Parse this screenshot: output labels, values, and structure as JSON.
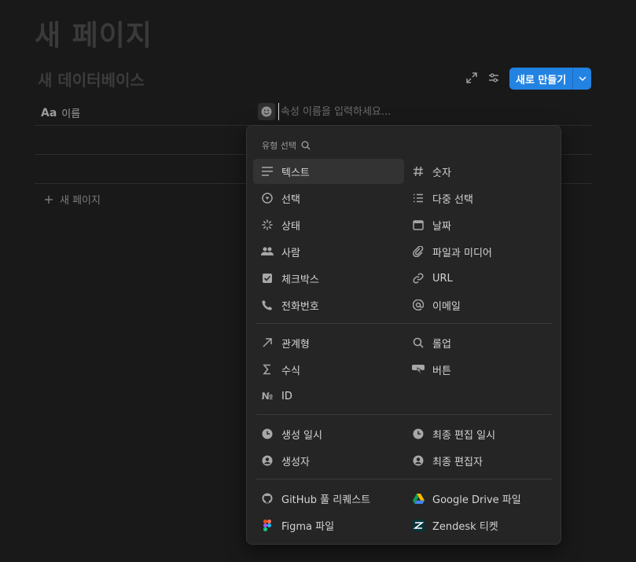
{
  "page": {
    "title": "새 페이지"
  },
  "database": {
    "title": "새 데이터베이스"
  },
  "toolbar": {
    "new_label": "새로 만들기"
  },
  "table": {
    "name_col_icon": "Aa",
    "name_col_label": "이름",
    "property_placeholder": "속성 이름을 입력하세요...",
    "add_page_label": "새 페이지"
  },
  "menu": {
    "header": "유형 선택",
    "items": [
      {
        "label": "텍스트",
        "icon": "text-icon"
      },
      {
        "label": "숫자",
        "icon": "number-icon"
      },
      {
        "label": "선택",
        "icon": "select-icon"
      },
      {
        "label": "다중 선택",
        "icon": "multi-select-icon"
      },
      {
        "label": "상태",
        "icon": "status-icon"
      },
      {
        "label": "날짜",
        "icon": "calendar-icon"
      },
      {
        "label": "사람",
        "icon": "people-icon"
      },
      {
        "label": "파일과 미디어",
        "icon": "attachment-icon"
      },
      {
        "label": "체크박스",
        "icon": "checkbox-icon"
      },
      {
        "label": "URL",
        "icon": "link-icon"
      },
      {
        "label": "전화번호",
        "icon": "phone-icon"
      },
      {
        "label": "이메일",
        "icon": "at-icon"
      },
      {
        "label": "관계형",
        "icon": "relation-arrow-icon"
      },
      {
        "label": "롤업",
        "icon": "search-icon"
      },
      {
        "label": "수식",
        "icon": "sigma-icon"
      },
      {
        "label": "버튼",
        "icon": "button-cursor-icon"
      },
      {
        "label": "ID",
        "icon": "numero-icon"
      },
      {
        "label": "생성 일시",
        "icon": "clock-icon"
      },
      {
        "label": "최종 편집 일시",
        "icon": "clock-icon"
      },
      {
        "label": "생성자",
        "icon": "user-circle-icon"
      },
      {
        "label": "최종 편집자",
        "icon": "user-circle-icon"
      },
      {
        "label": "GitHub 풀 리퀘스트",
        "icon": "github-icon"
      },
      {
        "label": "Google Drive 파일",
        "icon": "google-drive-icon"
      },
      {
        "label": "Figma 파일",
        "icon": "figma-icon"
      },
      {
        "label": "Zendesk 티켓",
        "icon": "zendesk-icon"
      }
    ]
  },
  "colors": {
    "accent": "#2383e2",
    "background": "#191919",
    "menu_bg": "#252525"
  }
}
